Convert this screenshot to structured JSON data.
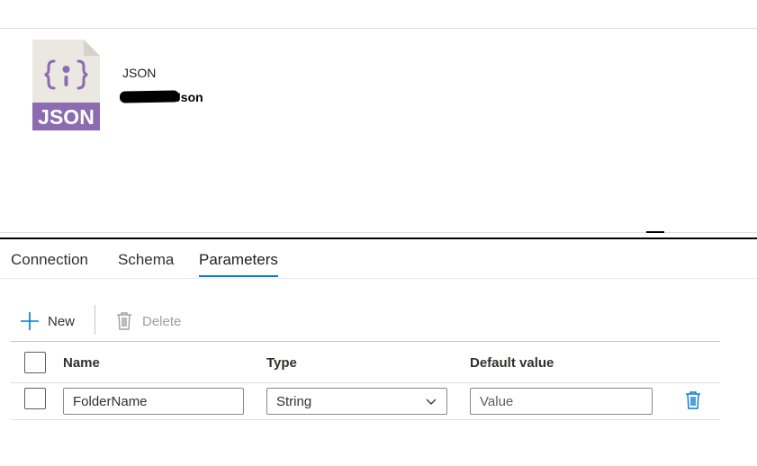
{
  "dataset": {
    "icon_label": "JSON",
    "type": "JSON",
    "name": "Json"
  },
  "tabs": [
    {
      "label": "Connection",
      "active": false
    },
    {
      "label": "Schema",
      "active": false
    },
    {
      "label": "Parameters",
      "active": true
    }
  ],
  "toolbar": {
    "new_label": "New",
    "delete_label": "Delete"
  },
  "grid": {
    "columns": [
      "Name",
      "Type",
      "Default value"
    ],
    "rows": [
      {
        "name": "FolderName",
        "type": "String",
        "default_value": "",
        "default_placeholder": "Value"
      }
    ]
  },
  "colors": {
    "accent": "#0078d4",
    "icon_purple": "#8c6bb0",
    "icon_page": "#ebe8e2"
  },
  "icons": [
    "json-file-icon",
    "plus-icon",
    "trash-icon",
    "chevron-down-icon"
  ]
}
